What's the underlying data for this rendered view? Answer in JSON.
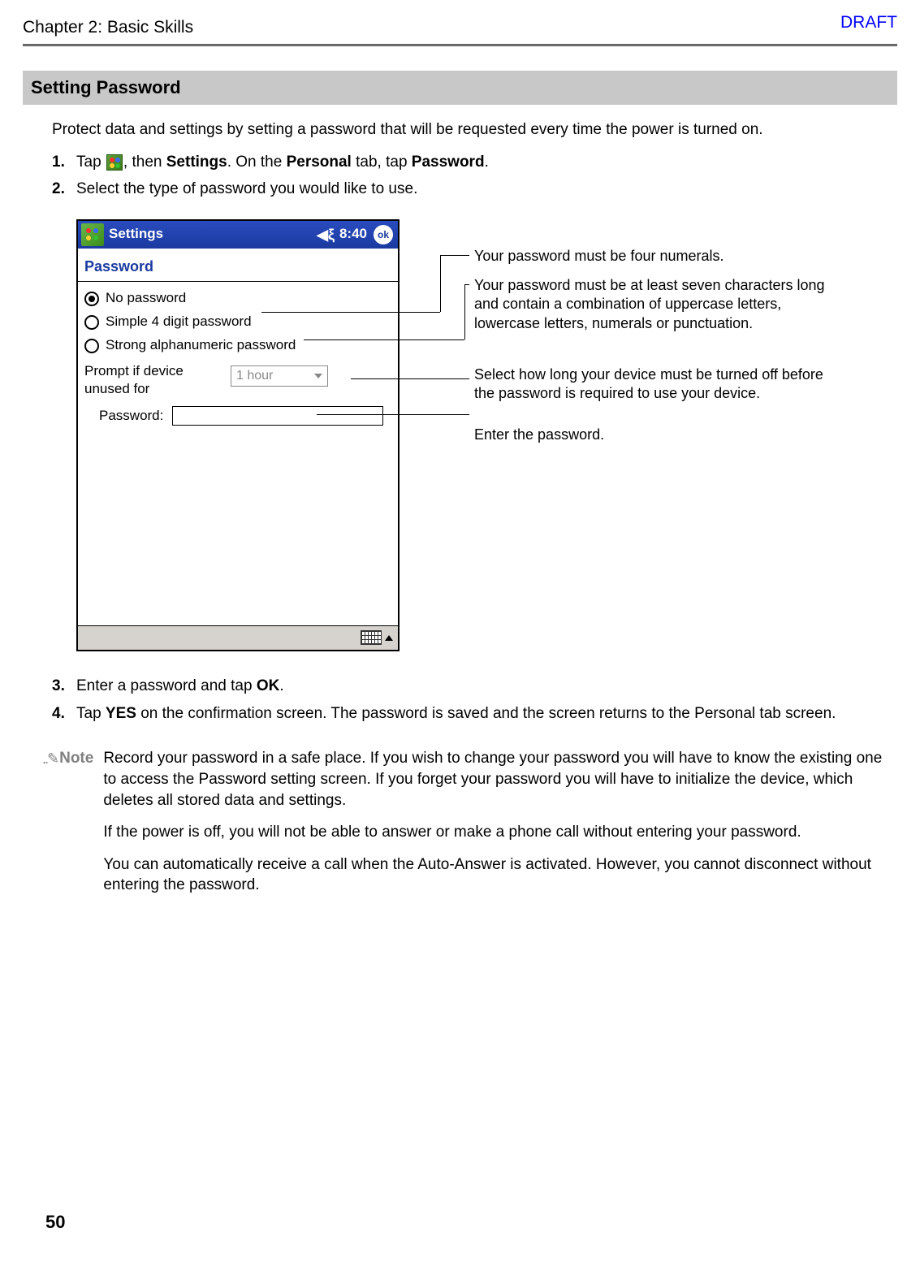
{
  "header": {
    "chapter": "Chapter 2: Basic Skills",
    "draft": "DRAFT"
  },
  "section_heading": "Setting Password",
  "intro": "Protect data and settings by setting a password that will be requested every time the power is turned on.",
  "steps": {
    "s1": {
      "num": "1.",
      "pre": "Tap ",
      "mid": ", then ",
      "settings": "Settings",
      "on_the": ". On the ",
      "personal": "Personal",
      "tab_tap": " tab, tap ",
      "password": "Password",
      "end": "."
    },
    "s2": {
      "num": "2.",
      "text": "Select the type of password you would like to use."
    },
    "s3": {
      "num": "3.",
      "pre": "Enter a password and tap ",
      "ok": "OK",
      "end": "."
    },
    "s4": {
      "num": "4.",
      "pre": "Tap ",
      "yes": "YES",
      "rest": " on the confirmation screen. The password is saved and the screen returns to the Personal tab screen."
    }
  },
  "pda": {
    "title": "Settings",
    "time": "8:40",
    "ok": "ok",
    "subtitle": "Password",
    "opt_none": "No password",
    "opt_simple": "Simple 4 digit password",
    "opt_strong": "Strong alphanumeric password",
    "prompt": "Prompt if device unused for",
    "dropdown": "1 hour",
    "password_label": "Password:"
  },
  "callouts": {
    "c1": "Your password must be four numerals.",
    "c2": "Your password must be at least seven characters long and contain a combination of uppercase letters, lowercase letters, numerals or punctuation.",
    "c3": "Select how long your device must be turned off before the password is required to use your device.",
    "c4": "Enter the password."
  },
  "note": {
    "label": "Note",
    "p1": "Record your password in a safe place. If you wish to change your password you will have to know the existing one to access the Password setting screen. If you forget your password you will have to initialize the device, which deletes all stored data and settings.",
    "p2": "If the power is off, you will not be able to answer or make a phone call without entering your password.",
    "p3": "You can automatically receive a call when the Auto-Answer is activated. However, you cannot disconnect without entering the password."
  },
  "page_number": "50"
}
